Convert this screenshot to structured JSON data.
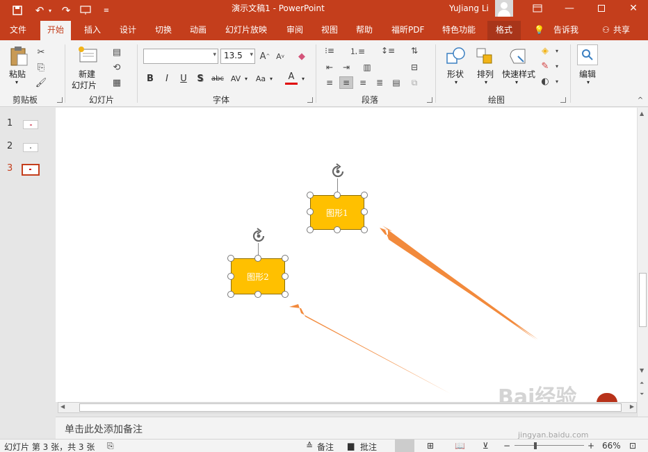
{
  "titlebar": {
    "title": "演示文稿1  -  PowerPoint",
    "user": "YuJiang Li"
  },
  "tabs": [
    "文件",
    "开始",
    "插入",
    "设计",
    "切换",
    "动画",
    "幻灯片放映",
    "审阅",
    "视图",
    "帮助",
    "福昕PDF",
    "特色功能",
    "格式",
    "告诉我",
    "共享"
  ],
  "ribbon": {
    "clipboard": {
      "paste": "粘贴",
      "group": "剪贴板"
    },
    "slides": {
      "new_slide_line1": "新建",
      "new_slide_line2": "幻灯片",
      "group": "幻灯片"
    },
    "font": {
      "font_name": "",
      "font_size": "13.5",
      "group": "字体",
      "bold": "B",
      "italic": "I",
      "underline": "U",
      "shadow": "S",
      "strike": "abc",
      "spacing": "AV",
      "case": "Aa",
      "color": "A"
    },
    "paragraph": {
      "group": "段落"
    },
    "drawing": {
      "shapes": "形状",
      "arrange": "排列",
      "quick_styles": "快速样式",
      "group": "绘图"
    },
    "editing": {
      "label": "编辑"
    }
  },
  "thumbnails": [
    "1",
    "2",
    "3"
  ],
  "slide": {
    "shape1_text": "图形1",
    "shape2_text": "图形2"
  },
  "notes_placeholder": "单击此处添加备注",
  "status": {
    "slide_info": "幻灯片 第 3 张，共 3 张",
    "notes": "备注",
    "comments": "批注",
    "zoom": "66%"
  },
  "watermark": {
    "brand": "Bai经验",
    "url": "jingyan.baidu.com"
  },
  "colors": {
    "accent": "#c43e1c",
    "shape_fill": "#ffc000",
    "arrow": "#f28a3c"
  }
}
